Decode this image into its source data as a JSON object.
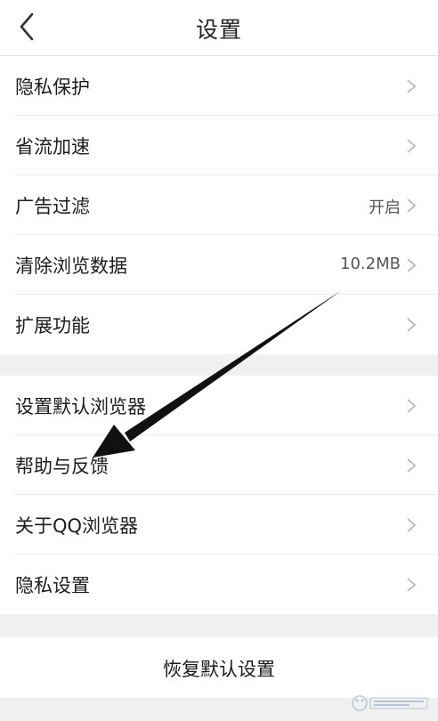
{
  "header": {
    "title": "设置",
    "back_icon": "chevron-left-icon"
  },
  "group1": {
    "items": [
      {
        "label": "隐私保护",
        "value": ""
      },
      {
        "label": "省流加速",
        "value": ""
      },
      {
        "label": "广告过滤",
        "value": "开启"
      },
      {
        "label": "清除浏览数据",
        "value": "10.2MB"
      },
      {
        "label": "扩展功能",
        "value": ""
      }
    ]
  },
  "group2": {
    "items": [
      {
        "label": "设置默认浏览器",
        "value": ""
      },
      {
        "label": "帮助与反馈",
        "value": ""
      },
      {
        "label": "关于QQ浏览器",
        "value": ""
      },
      {
        "label": "隐私设置",
        "value": ""
      }
    ]
  },
  "reset": {
    "label": "恢复默认设置"
  },
  "annotation": {
    "arrow_icon": "annotation-arrow-icon",
    "color": "#111111"
  },
  "colors": {
    "background": "#ffffff",
    "separator": "#f0f0f0",
    "chevron": "#b8b8b8",
    "text": "#1c1c1c"
  }
}
